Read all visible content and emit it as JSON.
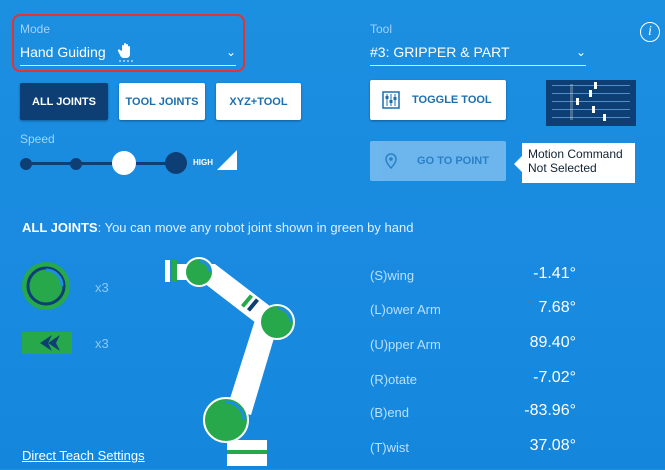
{
  "mode": {
    "label": "Mode",
    "value": "Hand Guiding"
  },
  "tool": {
    "label": "Tool",
    "value": "#3: GRIPPER & PART"
  },
  "joint_buttons": [
    "ALL JOINTS",
    "TOOL JOINTS",
    "XYZ+TOOL"
  ],
  "toggle_tool_label": "TOGGLE TOOL",
  "go_to_point_label": "GO TO POINT",
  "speed": {
    "label": "Speed",
    "high_label": "HIGH",
    "level": 3,
    "levels": 5
  },
  "tooltip": {
    "line1": "Motion Command",
    "line2": "Not Selected"
  },
  "info_icon": "info-icon",
  "description": {
    "heading": "ALL JOINTS",
    "text": ": You can move any robot joint shown in green by hand"
  },
  "legend": [
    {
      "icon": "rotate-joint-icon",
      "count": "x3"
    },
    {
      "icon": "arrow-joint-icon",
      "count": "x3"
    }
  ],
  "joints": [
    {
      "name": "(S)wing",
      "value": "-1.41°"
    },
    {
      "name": "(L)ower Arm",
      "value": "7.68°"
    },
    {
      "name": "(U)pper Arm",
      "value": "89.40°"
    },
    {
      "name": "(R)otate",
      "value": "-7.02°"
    },
    {
      "name": "(B)end",
      "value": "-83.96°"
    },
    {
      "name": "(T)wist",
      "value": "37.08°"
    }
  ],
  "settings_link": "Direct Teach Settings",
  "colors": {
    "accent_green": "#27a84a",
    "dark_blue": "#0e3f74",
    "background": "#1a8be0",
    "highlight": "#e53333"
  }
}
